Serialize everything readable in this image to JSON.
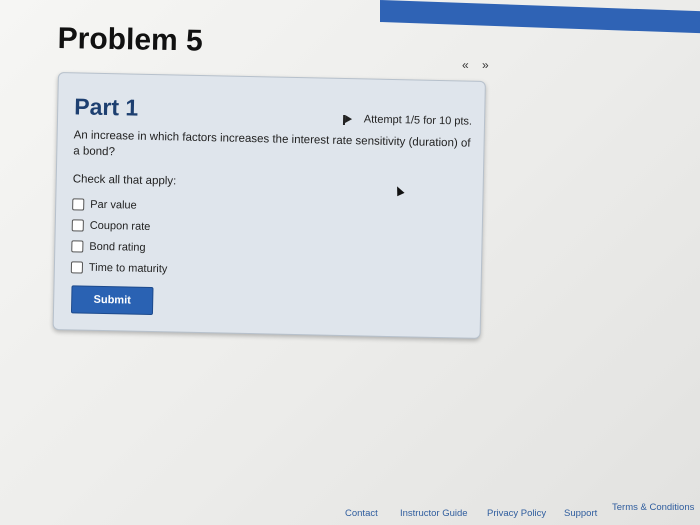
{
  "header": {
    "problem_title": "Problem 5",
    "nav_prev": "«",
    "nav_next": "»"
  },
  "part": {
    "title": "Part 1",
    "attempt": "Attempt 1/5 for 10 pts.",
    "question": "An increase in which factors increases the interest rate sensitivity (duration) of a bond?",
    "check_prompt": "Check all that apply:",
    "options": [
      {
        "label": "Par value",
        "checked": false
      },
      {
        "label": "Coupon rate",
        "checked": false
      },
      {
        "label": "Bond rating",
        "checked": false
      },
      {
        "label": "Time to maturity",
        "checked": false
      }
    ],
    "submit_label": "Submit"
  },
  "footer": {
    "links": [
      "Contact",
      "Instructor Guide",
      "Privacy Policy",
      "Support",
      "Terms & Conditions"
    ]
  },
  "colors": {
    "accent": "#2a62b3",
    "part_title": "#1d3f70",
    "card_bg": "#dfe5ec"
  }
}
